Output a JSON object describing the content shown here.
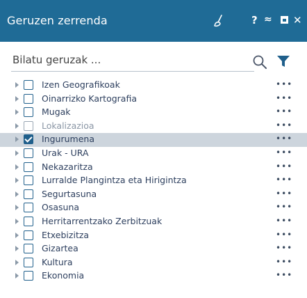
{
  "header": {
    "title": "Geruzen zerrenda",
    "help_label": "?",
    "collapse_label": "≈",
    "close_label": "✕"
  },
  "search": {
    "placeholder": "Bilatu geruzak ..."
  },
  "layers": [
    {
      "label": "Izen Geografikoak",
      "checked": false,
      "disabled": false,
      "selected": false,
      "more": "•••"
    },
    {
      "label": "Oinarrizko Kartografia",
      "checked": false,
      "disabled": false,
      "selected": false,
      "more": "•••"
    },
    {
      "label": "Mugak",
      "checked": false,
      "disabled": false,
      "selected": false,
      "more": "•••"
    },
    {
      "label": "Lokalizazioa",
      "checked": false,
      "disabled": true,
      "selected": false,
      "more": "•••"
    },
    {
      "label": "Ingurumena",
      "checked": true,
      "disabled": false,
      "selected": true,
      "more": "•••"
    },
    {
      "label": "Urak - URA",
      "checked": false,
      "disabled": false,
      "selected": false,
      "more": "•••"
    },
    {
      "label": "Nekazaritza",
      "checked": false,
      "disabled": false,
      "selected": false,
      "more": "•••"
    },
    {
      "label": "Lurralde Plangintza eta Hirigintza",
      "checked": false,
      "disabled": false,
      "selected": false,
      "more": "•••"
    },
    {
      "label": "Segurtasuna",
      "checked": false,
      "disabled": false,
      "selected": false,
      "more": "•••"
    },
    {
      "label": "Osasuna",
      "checked": false,
      "disabled": false,
      "selected": false,
      "more": "•••"
    },
    {
      "label": "Herritarrentzako Zerbitzuak",
      "checked": false,
      "disabled": false,
      "selected": false,
      "more": "•••"
    },
    {
      "label": "Etxebizitza",
      "checked": false,
      "disabled": false,
      "selected": false,
      "more": "•••"
    },
    {
      "label": "Gizartea",
      "checked": false,
      "disabled": false,
      "selected": false,
      "more": "•••"
    },
    {
      "label": "Kultura",
      "checked": false,
      "disabled": false,
      "selected": false,
      "more": "•••"
    },
    {
      "label": "Ekonomia",
      "checked": false,
      "disabled": false,
      "selected": false,
      "more": "•••"
    }
  ],
  "colors": {
    "header_bg": "#1f6b96",
    "accent": "#1f5f8b",
    "selected_row_bg": "#cdd5dd"
  },
  "icons": [
    "brush-icon",
    "help-icon",
    "collapse-icon",
    "maximize-icon",
    "close-icon",
    "search-icon",
    "filter-icon",
    "expand-arrow-icon",
    "more-options-icon"
  ]
}
